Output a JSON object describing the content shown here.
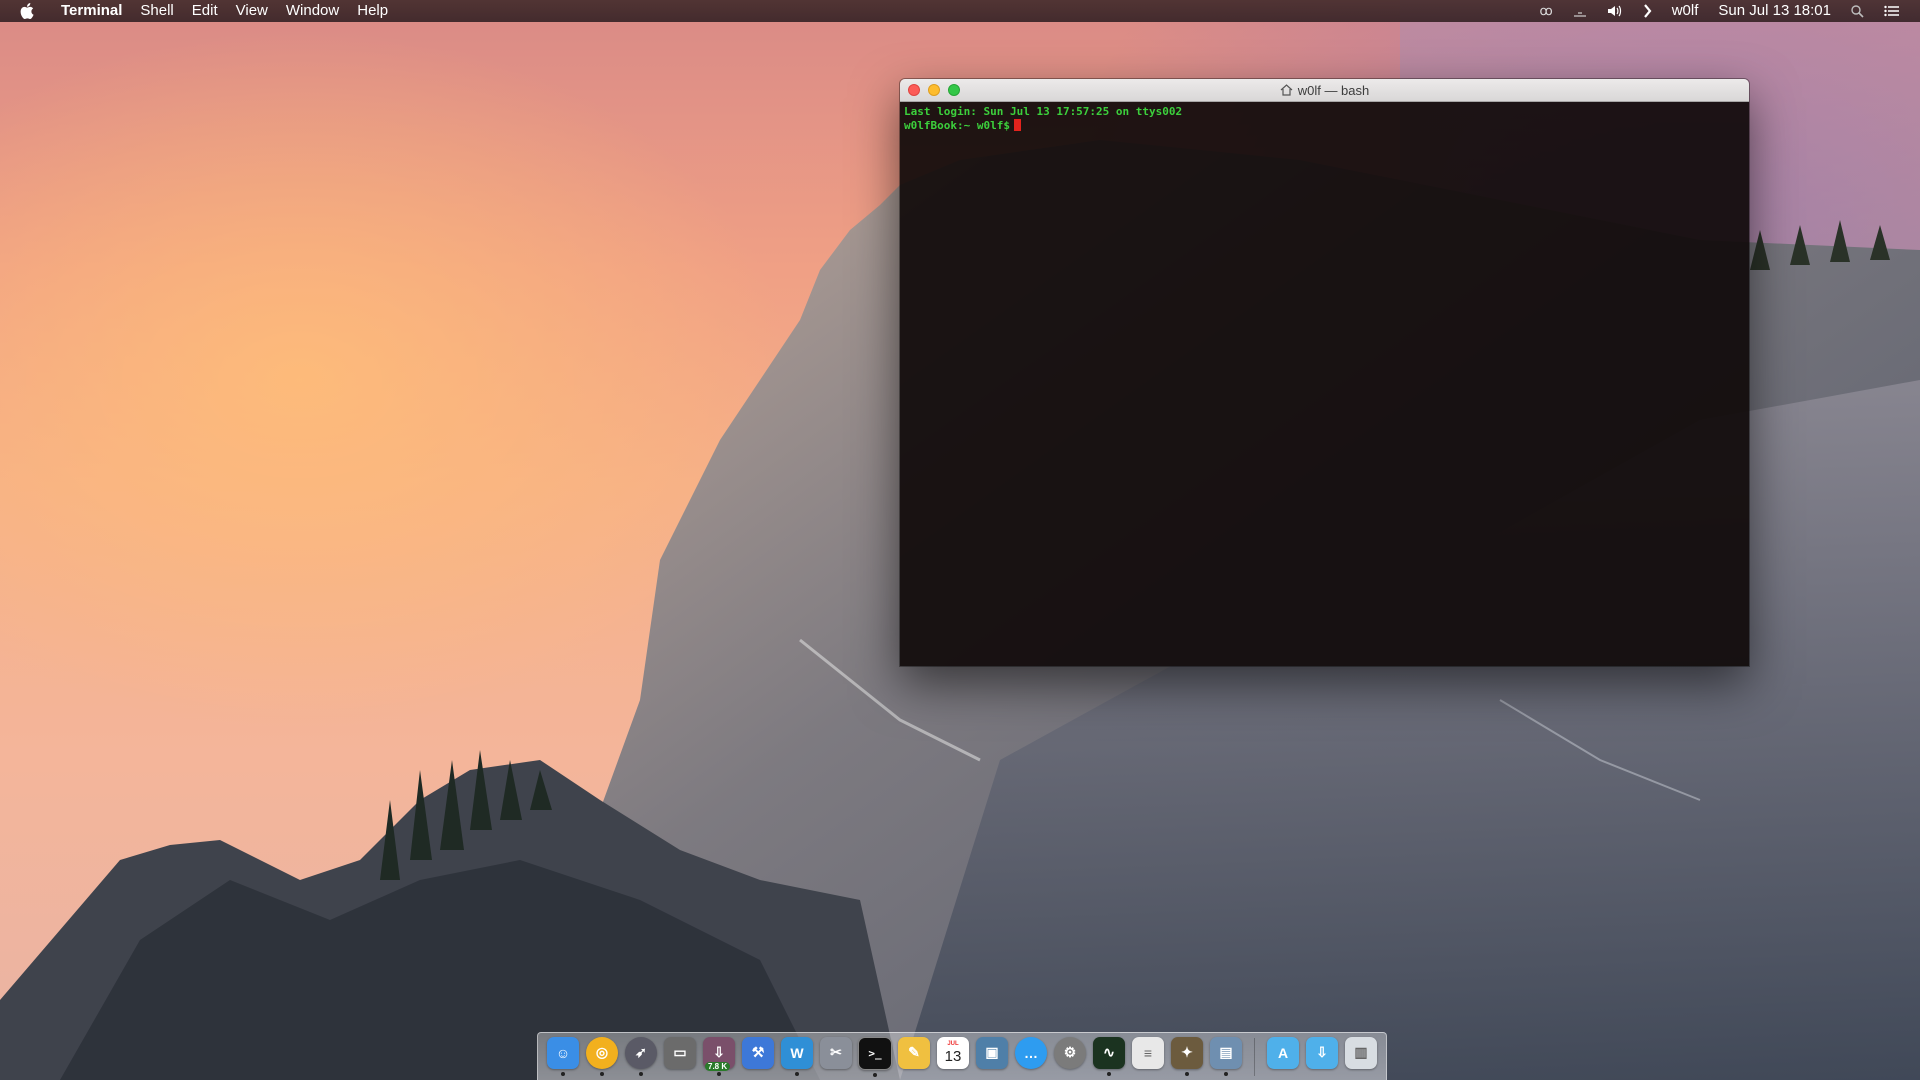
{
  "menubar": {
    "app_name": "Terminal",
    "menus": [
      "Shell",
      "Edit",
      "View",
      "Window",
      "Help"
    ],
    "tray": {
      "user": "w0lf",
      "datetime": "Sun Jul 13  18:01"
    }
  },
  "terminal_window": {
    "title": "w0lf — bash",
    "lines": [
      "Last login: Sun Jul 13 17:57:25 on ttys002",
      "w0lfBook:~ w0lf$"
    ]
  },
  "dock": {
    "items": [
      {
        "name": "finder",
        "icon": "finder-icon",
        "color": "#3a8ee6",
        "running": true
      },
      {
        "name": "chrome",
        "icon": "chrome-icon",
        "color": "#f2b01e",
        "running": true
      },
      {
        "name": "launchpad",
        "icon": "rocket-icon",
        "color": "#5a5a66",
        "running": true
      },
      {
        "name": "utility",
        "icon": "drive-icon",
        "color": "#6b6b6b",
        "running": false
      },
      {
        "name": "downloads",
        "icon": "download-icon",
        "color": "#7a4f6a",
        "running": true,
        "badge": "7.8 K"
      },
      {
        "name": "xcode",
        "icon": "hammer-icon",
        "color": "#3d78d8",
        "running": false
      },
      {
        "name": "wunderlist",
        "icon": "w-icon",
        "color": "#2f8fd6",
        "running": true
      },
      {
        "name": "scissors-app",
        "icon": "tools-icon",
        "color": "#8a8f99",
        "running": false
      },
      {
        "name": "terminal",
        "icon": "terminal-icon",
        "color": "#111111",
        "running": true
      },
      {
        "name": "textedit",
        "icon": "notepad-icon",
        "color": "#f0c040",
        "running": false
      },
      {
        "name": "calendar",
        "icon": "calendar-icon",
        "color": "#ffffff",
        "running": false,
        "day": "13",
        "month": "JUL"
      },
      {
        "name": "preview",
        "icon": "preview-icon",
        "color": "#4f7fa8",
        "running": false
      },
      {
        "name": "messages",
        "icon": "chat-icon",
        "color": "#2e9cf0",
        "running": false
      },
      {
        "name": "system-preferences",
        "icon": "gear-icon",
        "color": "#7b7b7b",
        "running": false
      },
      {
        "name": "activity-monitor",
        "icon": "graph-icon",
        "color": "#1b3320",
        "running": true
      },
      {
        "name": "script-editor",
        "icon": "scroll-icon",
        "color": "#e8e8e8",
        "running": false
      },
      {
        "name": "gimp",
        "icon": "gimp-icon",
        "color": "#6c5b3e",
        "running": true
      },
      {
        "name": "image-viewer",
        "icon": "photos-icon",
        "color": "#6f8fb0",
        "running": true
      },
      {
        "name": "applications-folder",
        "icon": "folder-icon",
        "color": "#4fb0ea",
        "running": false,
        "separator_before": true
      },
      {
        "name": "downloads-folder",
        "icon": "folder-download-icon",
        "color": "#4fb0ea",
        "running": false
      },
      {
        "name": "trash",
        "icon": "trash-icon",
        "color": "#d8dde2",
        "running": false
      }
    ]
  }
}
